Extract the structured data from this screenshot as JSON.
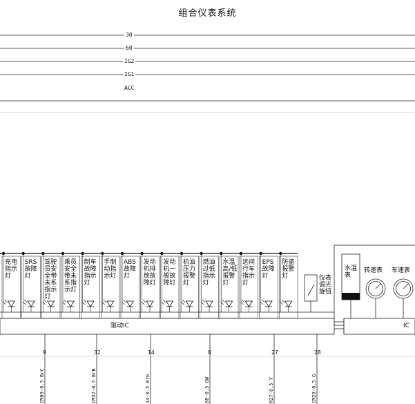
{
  "diagram": {
    "title": "组合仪表系统",
    "rails": [
      "30",
      "60",
      "IG2",
      "IG1",
      "ACC"
    ],
    "lamps": [
      {
        "label": "充电指示灯"
      },
      {
        "label": "SRS故障灯"
      },
      {
        "label": "驾驶员安全带未系指示灯"
      },
      {
        "label": "乘员安全带未系指示灯"
      },
      {
        "label": "制车故障指示灯"
      },
      {
        "label": "手制动指示灯"
      },
      {
        "label": "ABS故障灯"
      },
      {
        "label": "发动机排放故障灯"
      },
      {
        "label": "发动机一般故障灯"
      },
      {
        "label": "机油压力报警灯"
      },
      {
        "label": "燃油过低指示灯"
      },
      {
        "label": "水温高/低报警灯"
      },
      {
        "label": "远间行车指示灯"
      },
      {
        "label": "EPS故障灯"
      },
      {
        "label": "防盗报警灯"
      }
    ],
    "dimmer_label": "仪表调光旋钮",
    "water_temp_label": "水温表",
    "tach_label": "转速表",
    "speed_label": "车速表",
    "driver_ic_label": "驱动IC",
    "ic_label": "IC",
    "pins": [
      "9",
      "32",
      "14",
      "8",
      "27",
      "28"
    ],
    "wires": [
      "CM09-0.5 BrC",
      "CM32-0.5 BrB",
      "14-0.5 BrG",
      "08-0.5 GW",
      "M27-0.5 Y",
      "CM28-0.5 G"
    ]
  }
}
